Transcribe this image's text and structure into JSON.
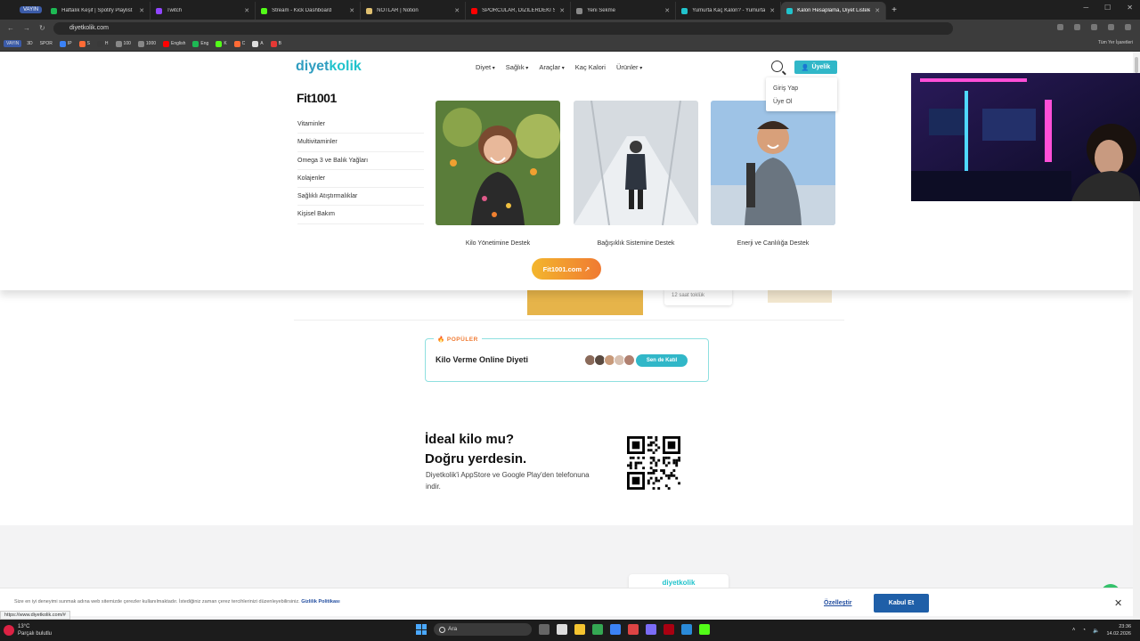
{
  "browser": {
    "tab_group_label": "VAYIN",
    "tabs": [
      {
        "title": "Haftalık Keşif | Spotify Playlist",
        "color": "#1db954"
      },
      {
        "title": "Twitch",
        "color": "#9146ff"
      },
      {
        "title": "Stream - Kick Dashboard",
        "color": "#53fc18"
      },
      {
        "title": "NOTLAR | Notion",
        "color": "#e0c070"
      },
      {
        "title": "SPORCULAR, DİZİLERDEKİ SPOR",
        "color": "#ff0000"
      },
      {
        "title": "Yeni Sekme",
        "color": "#888888"
      },
      {
        "title": "Yumurta Kaç Kalori? - Yumurta",
        "color": "#21c3cc"
      },
      {
        "title": "Kalori Hesaplama, Diyet Listeleri",
        "color": "#21c3cc",
        "active": true
      }
    ],
    "new_tab": "+",
    "address": "diyetkolik.com",
    "bookmarks": [
      {
        "label": "VAYIN",
        "pill": true,
        "color": "#3b5ba8"
      },
      {
        "label": "3D",
        "color": ""
      },
      {
        "label": "SPOR",
        "color": ""
      },
      {
        "label": "IP",
        "color": "#3b82f6"
      },
      {
        "label": "S",
        "color": "#ff6b35"
      },
      {
        "label": "H",
        "color": "#3a3a3a"
      },
      {
        "label": "100",
        "color": "#888"
      },
      {
        "label": "1000",
        "color": "#888"
      },
      {
        "label": "English",
        "color": "#ff0000"
      },
      {
        "label": "Eng",
        "color": "#1db954"
      },
      {
        "label": "K",
        "color": "#53fc18"
      },
      {
        "label": "C",
        "color": "#ff6b35"
      },
      {
        "label": "A",
        "color": "#dddddd"
      },
      {
        "label": "B",
        "color": "#e53935"
      }
    ],
    "bookmarks_right": "Tüm Yer İşaretleri",
    "status_url": "https://www.diyetkolik.com/#"
  },
  "site": {
    "logo_main": "diyet",
    "logo_accent": "kolik",
    "nav": [
      {
        "label": "Diyet",
        "dropdown": true
      },
      {
        "label": "Sağlık",
        "dropdown": true
      },
      {
        "label": "Araçlar",
        "dropdown": true
      },
      {
        "label": "Kaç Kalori",
        "dropdown": false
      },
      {
        "label": "Ürünler",
        "dropdown": true
      }
    ],
    "member_button": "Üyelik",
    "member_menu": [
      "Giriş Yap",
      "Üye Ol"
    ],
    "fit_logo": "Fit1001",
    "mega_menu": [
      "Vitaminler",
      "Multivitaminler",
      "Omega 3 ve Balık Yağları",
      "Kolajenler",
      "Sağlıklı Atıştırmalıklar",
      "Kişisel Bakım"
    ],
    "promos": [
      {
        "caption": "Kilo Yönetimine Destek"
      },
      {
        "caption": "Bağışıklık Sistemine Destek"
      },
      {
        "caption": "Enerji ve Canlılığa Destek"
      }
    ],
    "fit_button": "Fit1001.com",
    "bg_card": "12 saat toklük",
    "popular_label": "POPÜLER",
    "popular_title": "Kilo Verme Online Diyeti",
    "popular_cta": "Sen de Katıl",
    "ideal_line1": "İdeal kilo mu?",
    "ideal_line2": "Doğru yerdesin.",
    "ideal_sub": "Diyetkolik'i AppStore ve Google Play'den telefonuna indir.",
    "phone_logo": "diyetkolik",
    "cookie_text": "Size en iyi deneyimi sunmak adına web sitemizde çerezler kullanılmaktadır. İstediğiniz zaman çerez tercihlerinizi düzenleyebilirsiniz.",
    "cookie_link": "Gizlilik Politikası",
    "cookie_customize": "Özelleştir",
    "cookie_accept": "Kabul Et",
    "cookie_close": "✕"
  },
  "taskbar": {
    "weather_temp": "13°C",
    "weather_desc": "Parçalı bulutlu",
    "search_placeholder": "Ara",
    "time": "23:36",
    "date": "14.02.2026"
  }
}
